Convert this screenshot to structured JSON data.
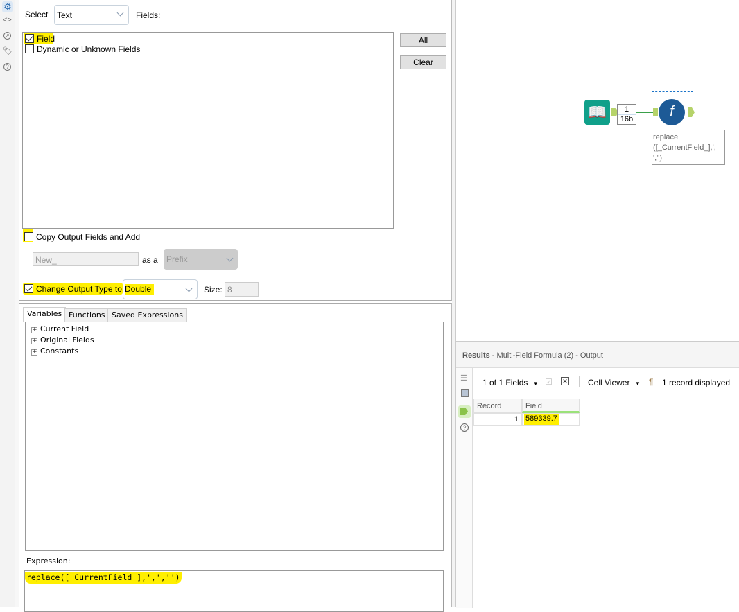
{
  "sidebar": {
    "icons": [
      "gear-icon",
      "code-icon",
      "link-icon",
      "tag-icon",
      "help-icon"
    ]
  },
  "config": {
    "select_label": "Select",
    "select_value": "Text",
    "fields_label": "Fields:",
    "fields": [
      {
        "label": "Field",
        "checked": true
      },
      {
        "label": "Dynamic or Unknown Fields",
        "checked": false
      }
    ],
    "all_button": "All",
    "clear_button": "Clear",
    "copy_output_label": "Copy Output Fields and Add",
    "copy_output_checked": false,
    "prefix_input": "New_",
    "as_a_label": "as a",
    "prefix_select": "Prefix",
    "change_type_label": "Change Output Type to",
    "change_type_checked": true,
    "type_value": "Double",
    "size_label": "Size:",
    "size_value": "8"
  },
  "expression_panel": {
    "tabs": [
      "Variables",
      "Functions",
      "Saved Expressions"
    ],
    "tree": [
      "Current Field",
      "Original Fields",
      "Constants"
    ],
    "expression_label": "Expression:",
    "expression": "replace([_CurrentField_],',',''",
    "expression_close": ")"
  },
  "canvas": {
    "connection_count": "1",
    "connection_size": "16b",
    "annotation": "replace ([_CurrentField_],', ','')"
  },
  "results": {
    "title": "Results",
    "subtitle": " - Multi-Field Formula (2) - Output",
    "fields_dropdown": "1 of 1 Fields",
    "cell_viewer": "Cell Viewer",
    "records_displayed": "1 record displayed",
    "columns": [
      "Record",
      "Field"
    ],
    "rows": [
      [
        "1",
        "589339.7"
      ]
    ]
  }
}
